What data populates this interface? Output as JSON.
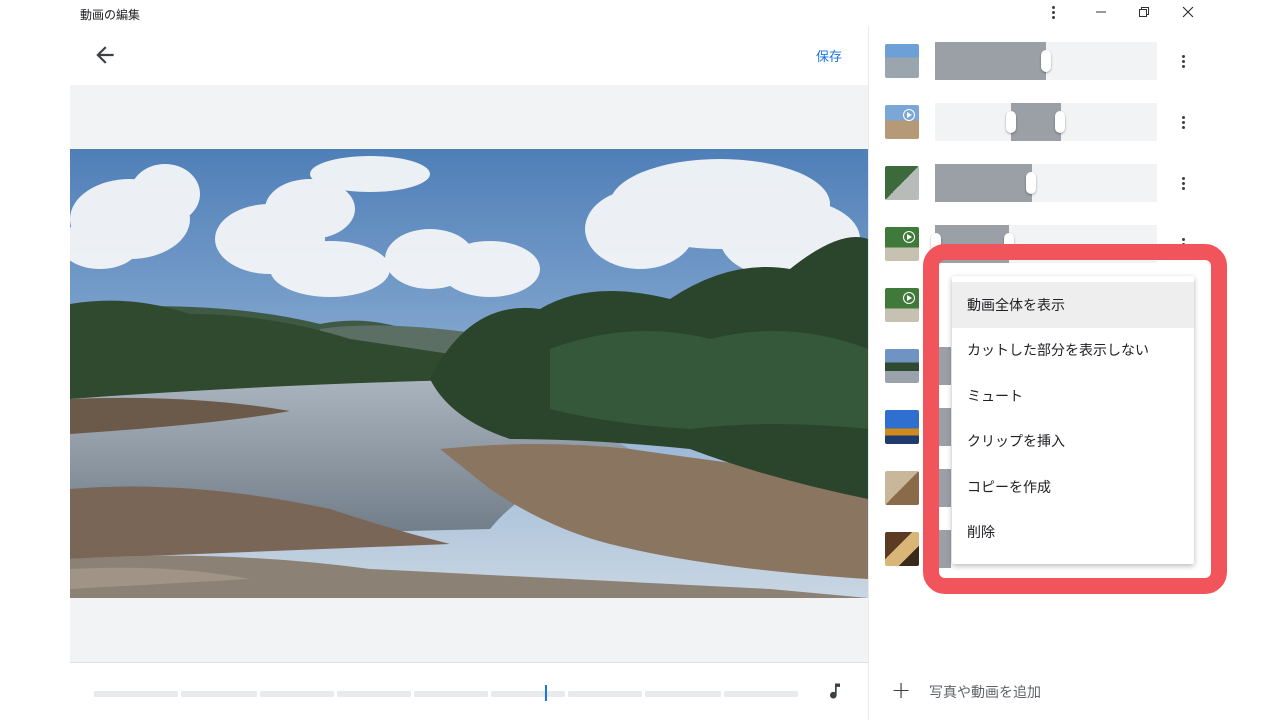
{
  "window": {
    "title": "動画の編集",
    "buttons": {
      "more": "more-vert-icon",
      "minimize": "—",
      "restore": "❐",
      "close": "✕"
    }
  },
  "toolbar": {
    "save_label": "保存",
    "back_icon": "arrow-back-icon"
  },
  "preview": {
    "image": "mangrove river landscape photo"
  },
  "timeline": {
    "segments": 9,
    "playhead_fraction": 0.6,
    "music_icon": "music-note-icon"
  },
  "clips": [
    {
      "thumb": "waterfall",
      "has_video": false,
      "fill_start": 0.0,
      "fill_end": 0.5
    },
    {
      "thumb": "beach",
      "has_video": true,
      "fill_start": 0.34,
      "fill_end": 0.56
    },
    {
      "thumb": "boardwalk",
      "has_video": false,
      "fill_start": 0.0,
      "fill_end": 0.44
    },
    {
      "thumb": "forest-path",
      "has_video": true,
      "fill_start": 0.0,
      "fill_end": 0.33
    },
    {
      "thumb": "forest-path",
      "has_video": true,
      "fill_start": 0.0,
      "fill_end": 0.0
    },
    {
      "thumb": "river",
      "has_video": false,
      "fill_start": 0.0,
      "fill_end": 0.1
    },
    {
      "thumb": "sunset",
      "has_video": false,
      "fill_start": 0.0,
      "fill_end": 0.1
    },
    {
      "thumb": "room",
      "has_video": false,
      "fill_start": 0.0,
      "fill_end": 0.1
    },
    {
      "thumb": "food",
      "has_video": false,
      "fill_start": 0.0,
      "fill_end": 0.1
    }
  ],
  "context_menu": {
    "items": [
      {
        "label": "動画全体を表示",
        "active": true
      },
      {
        "label": "カットした部分を表示しない",
        "active": false
      },
      {
        "label": "ミュート",
        "active": false
      },
      {
        "label": "クリップを挿入",
        "active": false
      },
      {
        "label": "コピーを作成",
        "active": false
      },
      {
        "label": "削除",
        "active": false
      }
    ]
  },
  "add_media": {
    "label": "写真や動画を追加",
    "icon": "plus-icon"
  },
  "colors": {
    "accent": "#1a73e8",
    "highlight": "#f2545b",
    "track": "#f1f3f4",
    "fill": "#9aa0a6"
  }
}
